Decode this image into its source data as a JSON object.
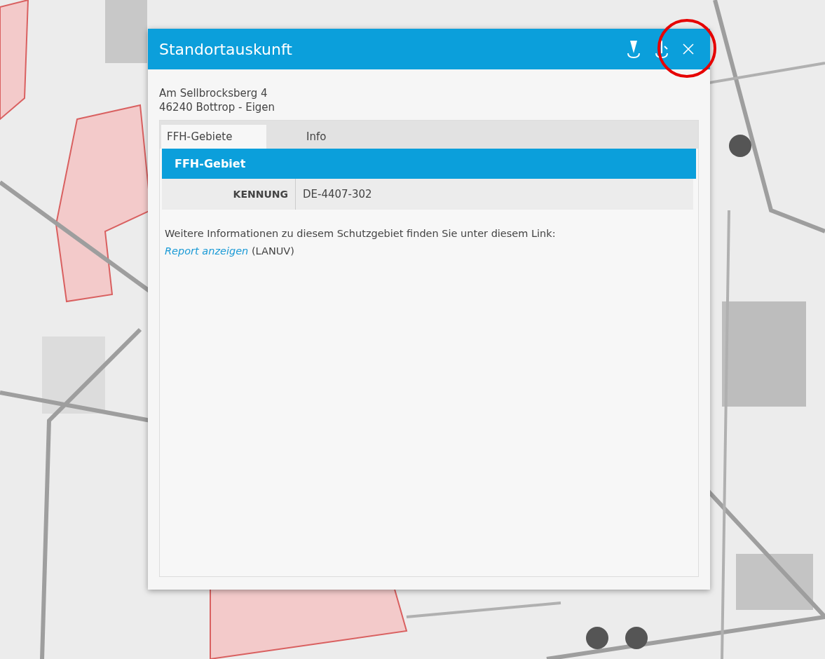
{
  "popup": {
    "title": "Standortauskunft",
    "address": [
      "Am Sellbrocksberg 4",
      "46240 Bottrop - Eigen"
    ],
    "tabs": [
      {
        "label": "FFH-Gebiete",
        "selected": true
      },
      {
        "label": "Info",
        "selected": false
      }
    ],
    "section": {
      "title": "FFH-Gebiet",
      "rows": [
        {
          "key": "KENNUNG",
          "value": "DE-4407-302"
        }
      ]
    },
    "note": {
      "text": "Weitere Informationen zu diesem Schutzgebiet finden Sie unter diesem Link:",
      "link": "Report anzeigen",
      "suffix": "(LANUV)"
    }
  }
}
